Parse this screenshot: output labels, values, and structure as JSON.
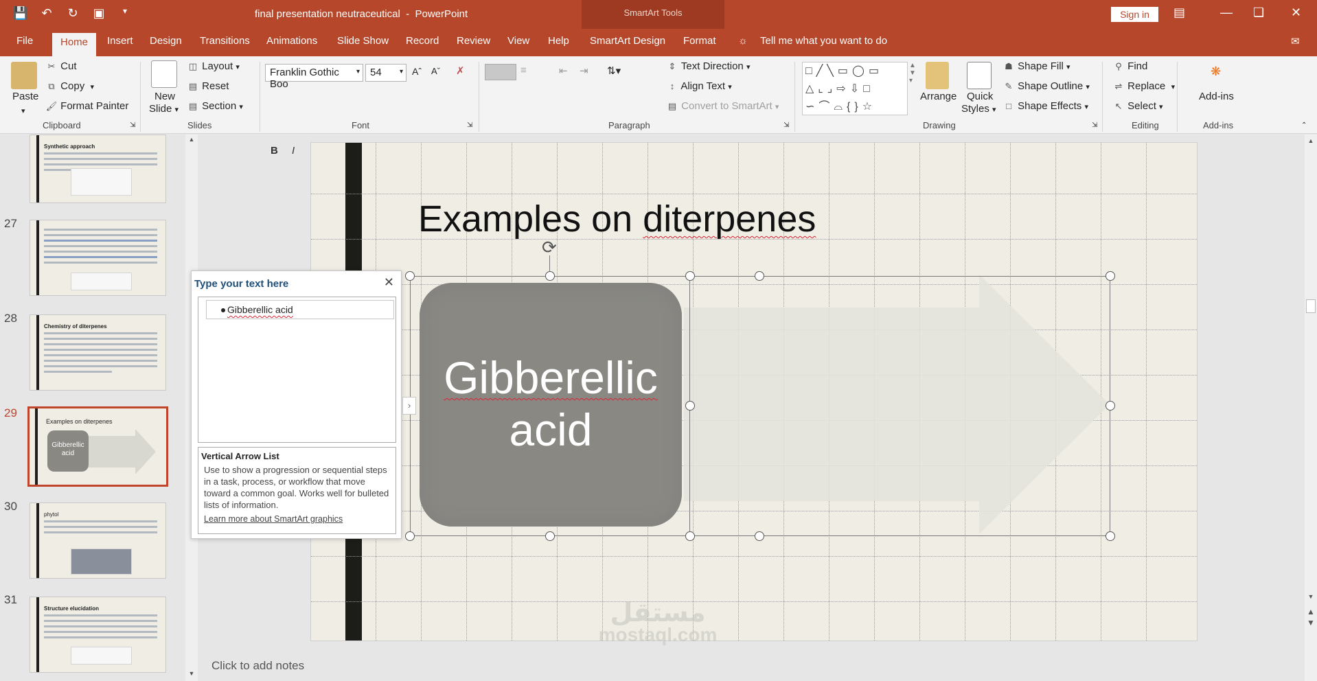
{
  "window": {
    "doc_name": "final presentation neutraceutical",
    "app_name": "PowerPoint",
    "tools_label": "SmartArt Tools",
    "sign_in": "Sign in"
  },
  "tabs": [
    "File",
    "Home",
    "Insert",
    "Design",
    "Transitions",
    "Animations",
    "Slide Show",
    "Record",
    "Review",
    "View",
    "Help",
    "SmartArt Design",
    "Format"
  ],
  "tell_me": "Tell me what you want to do",
  "ribbon": {
    "clipboard": {
      "paste": "Paste",
      "cut": "Cut",
      "copy": "Copy",
      "format_painter": "Format Painter",
      "label": "Clipboard"
    },
    "slides": {
      "new_slide_1": "New",
      "new_slide_2": "Slide",
      "layout": "Layout",
      "reset": "Reset",
      "section": "Section",
      "label": "Slides"
    },
    "font": {
      "family": "Franklin Gothic Boo",
      "size": "54",
      "label": "Font"
    },
    "paragraph": {
      "text_direction": "Text Direction",
      "align_text": "Align Text",
      "convert": "Convert to SmartArt",
      "label": "Paragraph"
    },
    "drawing": {
      "arrange": "Arrange",
      "quick_1": "Quick",
      "quick_2": "Styles",
      "shape_fill": "Shape Fill",
      "shape_outline": "Shape Outline",
      "shape_effects": "Shape Effects",
      "label": "Drawing"
    },
    "editing": {
      "find": "Find",
      "replace": "Replace",
      "select": "Select",
      "label": "Editing"
    },
    "addins": {
      "button": "Add-ins",
      "label": "Add-ins"
    }
  },
  "thumbnails": [
    {
      "num": "",
      "title": "Synthetic approach"
    },
    {
      "num": "27",
      "title": ""
    },
    {
      "num": "28",
      "title": "Chemistry of diterpenes"
    },
    {
      "num": "29",
      "title": "Examples on diterpenes",
      "box": "Gibberellic acid",
      "selected": true
    },
    {
      "num": "30",
      "title": "phytol"
    },
    {
      "num": "31",
      "title": "Structure elucidation"
    }
  ],
  "slide": {
    "title_1": "Examples on ",
    "title_2": "diterpenes",
    "box_1": "Gibberellic",
    "box_2": "acid"
  },
  "text_pane": {
    "header": "Type your text here",
    "item": "Gibberellic acid",
    "info_title": "Vertical Arrow List",
    "info_body": "Use to show a progression or sequential steps in a task, process, or workflow that move toward a common goal. Works well for bulleted lists of information.",
    "info_link": "Learn more about SmartArt graphics"
  },
  "notes": "Click to add notes",
  "watermark": {
    "arabic": "مستقل",
    "latin": "mostaql.com"
  }
}
